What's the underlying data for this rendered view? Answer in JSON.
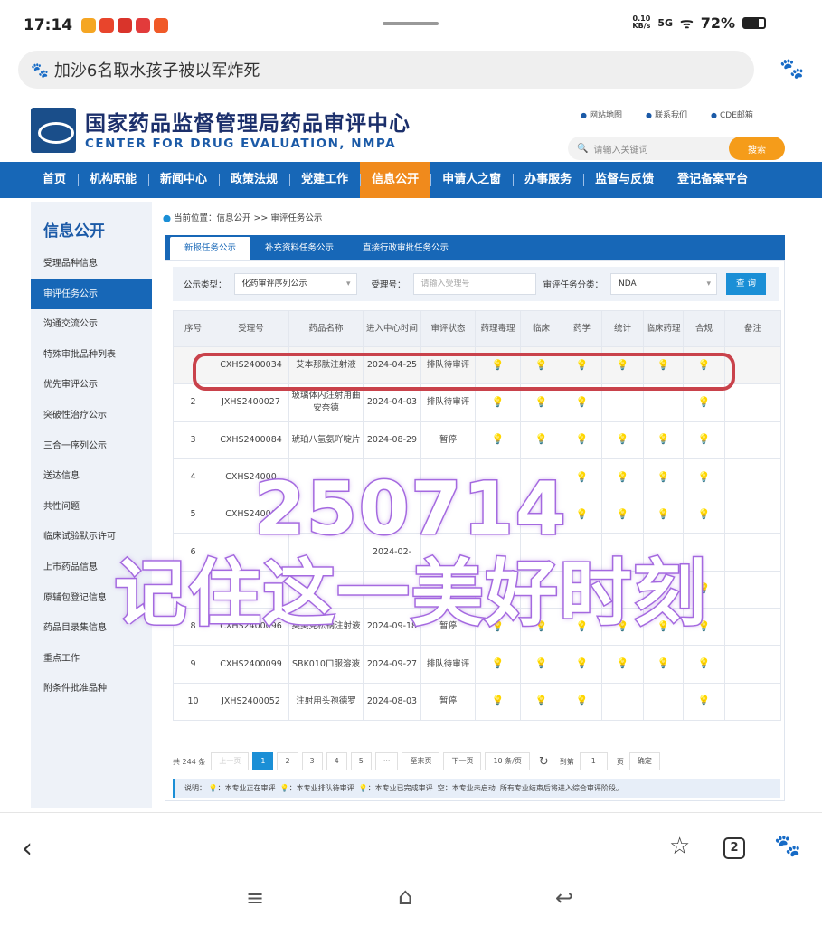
{
  "status": {
    "time": "17:14",
    "net_speed": "0.10",
    "net_unit": "KB/s",
    "signal": "5G",
    "battery": "72%"
  },
  "browser": {
    "query": "加沙6名取水孩子被以军炸死"
  },
  "site": {
    "title_cn": "国家药品监督管理局药品审评中心",
    "title_en": "CENTER FOR DRUG EVALUATION, NMPA",
    "links": [
      "网站地图",
      "联系我们",
      "CDE邮箱"
    ],
    "search_placeholder": "请输入关键词",
    "search_button": "搜索",
    "nav": [
      "首页",
      "机构职能",
      "新闻中心",
      "政策法规",
      "党建工作",
      "信息公开",
      "申请人之窗",
      "办事服务",
      "监督与反馈",
      "登记备案平台"
    ],
    "nav_active": "信息公开"
  },
  "sidebar": {
    "title": "信息公开",
    "items": [
      "受理品种信息",
      "审评任务公示",
      "沟通交流公示",
      "特殊审批品种列表",
      "优先审评公示",
      "突破性治疗公示",
      "三合一序列公示",
      "送达信息",
      "共性问题",
      "临床试验默示许可",
      "上市药品信息",
      "原辅包登记信息",
      "药品目录集信息",
      "重点工作",
      "附条件批准品种"
    ],
    "active": "审评任务公示"
  },
  "main": {
    "breadcrumb": "当前位置：信息公开 >> 审评任务公示",
    "tabs": [
      "新报任务公示",
      "补充资料任务公示",
      "直接行政审批任务公示"
    ],
    "filters": {
      "type_label": "公示类型：",
      "type_value": "化药审评序列公示",
      "accept_label": "受理号：",
      "accept_placeholder": "请输入受理号",
      "category_label": "审评任务分类：",
      "category_value": "NDA",
      "query_button": "查 询"
    },
    "table": {
      "headers": [
        "序号",
        "受理号",
        "药品名称",
        "进入中心时间",
        "审评状态",
        "药理毒理",
        "临床",
        "药学",
        "统计",
        "临床药理",
        "合规",
        "备注"
      ],
      "rows": [
        {
          "no": "",
          "id": "CXHS2400034",
          "name": "艾本那肽注射液",
          "date": "2024-04-25",
          "status": "排队待审评",
          "marks": [
            "w",
            "w",
            "w",
            "w",
            "w",
            "w"
          ]
        },
        {
          "no": "2",
          "id": "JXHS2400027",
          "name": "玻璃体内注射用曲安奈德",
          "date": "2024-04-03",
          "status": "排队待审评",
          "marks": [
            "w",
            "w",
            "w",
            "",
            "",
            "w"
          ]
        },
        {
          "no": "3",
          "id": "CXHS2400084",
          "name": "琥珀八氢氨吖啶片",
          "date": "2024-08-29",
          "status": "暂停",
          "marks": [
            "w",
            "w",
            "y",
            "w",
            "w",
            "w"
          ]
        },
        {
          "no": "4",
          "id": "CXHS24000",
          "name": "",
          "date": "",
          "status": "",
          "marks": [
            "",
            "",
            "y",
            "w",
            "w",
            "w"
          ]
        },
        {
          "no": "5",
          "id": "CXHS24000",
          "name": "",
          "date": "",
          "status": "",
          "marks": [
            "",
            "",
            "w",
            "w",
            "w",
            "w"
          ]
        },
        {
          "no": "6",
          "id": "",
          "name": "",
          "date": "2024-02-",
          "status": "",
          "marks": [
            "",
            "",
            "",
            "",
            "",
            ""
          ]
        },
        {
          "no": "7",
          "id": "",
          "name": "",
          "date": "12",
          "status": "",
          "marks": [
            "",
            "",
            "",
            "",
            "",
            "w"
          ]
        },
        {
          "no": "8",
          "id": "CXHS2400096",
          "name": "奥美克松钠注射液",
          "date": "2024-09-18",
          "status": "暂停",
          "marks": [
            "w",
            "w",
            "y",
            "w",
            "w",
            "w"
          ]
        },
        {
          "no": "9",
          "id": "CXHS2400099",
          "name": "SBK010口服溶液",
          "date": "2024-09-27",
          "status": "排队待审评",
          "marks": [
            "w",
            "w",
            "w",
            "w",
            "w",
            "w"
          ]
        },
        {
          "no": "10",
          "id": "JXHS2400052",
          "name": "注射用头孢德罗",
          "date": "2024-08-03",
          "status": "暂停",
          "marks": [
            "w",
            "w",
            "y",
            "",
            "",
            "w"
          ]
        }
      ]
    },
    "pager": {
      "total": "共 244 条",
      "prev": "上一页",
      "pages": [
        "1",
        "2",
        "3",
        "4",
        "5",
        "···"
      ],
      "last": "至末页",
      "next": "下一页",
      "size": "10 条/页",
      "goto_label": "到第",
      "goto_value": "1",
      "goto_unit": "页",
      "confirm": "确定"
    },
    "legend": {
      "label": "说明：",
      "green": "本专业正在审评",
      "yellow": "本专业排队待审评",
      "white": "本专业已完成审评",
      "empty": "空：本专业未启动",
      "note": "所有专业结束后将进入综合审评阶段。"
    }
  },
  "overlay": {
    "line1": "250714",
    "line2": "记住这一美好时刻"
  },
  "bottom": {
    "tabs_count": "2"
  }
}
